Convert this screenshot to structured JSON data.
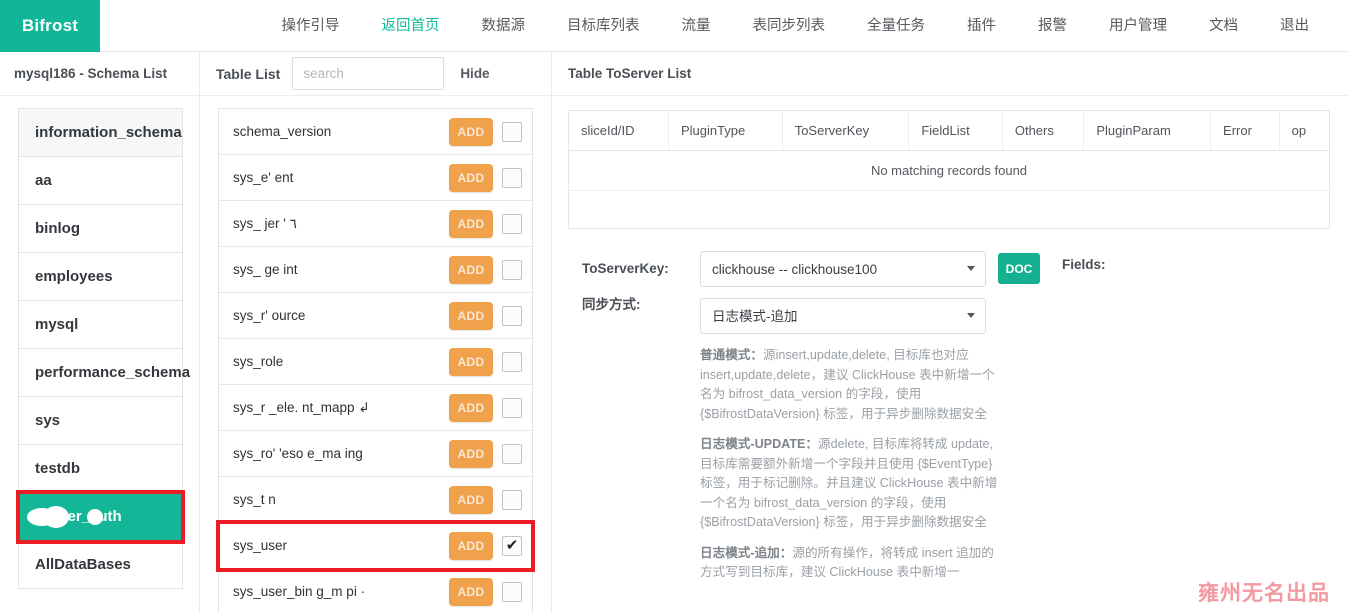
{
  "brand": {
    "name": "Bifrost"
  },
  "nav": {
    "items": [
      {
        "label": "操作引导",
        "active": false
      },
      {
        "label": "返回首页",
        "active": true
      },
      {
        "label": "数据源",
        "active": false
      },
      {
        "label": "目标库列表",
        "active": false
      },
      {
        "label": "流量",
        "active": false
      },
      {
        "label": "表同步列表",
        "active": false
      },
      {
        "label": "全量任务",
        "active": false
      },
      {
        "label": "插件",
        "active": false
      },
      {
        "label": "报警",
        "active": false
      },
      {
        "label": "用户管理",
        "active": false
      },
      {
        "label": "文档",
        "active": false
      },
      {
        "label": "退出",
        "active": false
      }
    ]
  },
  "schema_panel": {
    "title": "mysql186 - Schema List",
    "items": [
      {
        "label": "information_schema",
        "state": "hover"
      },
      {
        "label": "aa",
        "state": "normal"
      },
      {
        "label": "binlog",
        "state": "normal"
      },
      {
        "label": "employees",
        "state": "normal"
      },
      {
        "label": "mysql",
        "state": "normal"
      },
      {
        "label": "performance_schema",
        "state": "normal"
      },
      {
        "label": "sys",
        "state": "normal"
      },
      {
        "label": "testdb",
        "state": "normal"
      },
      {
        "label": "ranger_auth",
        "state": "selected"
      },
      {
        "label": "AllDataBases",
        "state": "normal"
      }
    ]
  },
  "table_panel": {
    "title": "Table List",
    "search_placeholder": "search",
    "search_value": "",
    "hide_label": "Hide",
    "add_label": "ADD",
    "checked_mark": "✔",
    "rows": [
      {
        "name": "schema_version",
        "checked": false,
        "highlight": false
      },
      {
        "name": "sys_e'   ent",
        "checked": false,
        "highlight": false
      },
      {
        "name": "sys_   jer '  ٦",
        "checked": false,
        "highlight": false
      },
      {
        "name": "sys_   ge   int",
        "checked": false,
        "highlight": false
      },
      {
        "name": "sys_r'  ource",
        "checked": false,
        "highlight": false
      },
      {
        "name": "sys_role",
        "checked": false,
        "highlight": false
      },
      {
        "name": "sys_r  _ele.  nt_mapp   ↲",
        "checked": false,
        "highlight": false
      },
      {
        "name": "sys_ro'  'eso   e_ma   ing",
        "checked": false,
        "highlight": false
      },
      {
        "name": "sys_t    n",
        "checked": false,
        "highlight": false
      },
      {
        "name": "sys_user",
        "checked": true,
        "highlight": true
      },
      {
        "name": "sys_user_bin    g_m   pi  ·",
        "checked": false,
        "highlight": false
      }
    ]
  },
  "right_panel": {
    "title": "Table ToServer List",
    "table": {
      "columns": [
        "sliceId/ID",
        "PluginType",
        "ToServerKey",
        "FieldList",
        "Others",
        "PluginParam",
        "Error",
        "op"
      ],
      "empty_message": "No matching records found",
      "rows": []
    },
    "form": {
      "toserverkey_label": "ToServerKey:",
      "toserverkey_value": "clickhouse -- clickhouse100",
      "toserverkey_options": [
        "clickhouse -- clickhouse100"
      ],
      "syncmode_label": "同步方式:",
      "syncmode_value": "日志模式-追加",
      "syncmode_options": [
        "普通模式",
        "日志模式-UPDATE",
        "日志模式-追加"
      ],
      "doc_label": "DOC",
      "fields_label": "Fields:"
    },
    "help": [
      {
        "title": "普通模式：",
        "body": "源insert,update,delete, 目标库也对应 insert,update,delete，建议 ClickHouse 表中新增一个名为 bifrost_data_version 的字段，使用 {$BifrostDataVersion} 标签，用于异步删除数据安全"
      },
      {
        "title": "日志模式-UPDATE：",
        "body": "源delete, 目标库将转成 update, 目标库需要额外新增一个字段并且使用 {$EventType}标签，用于标记删除。并且建议 ClickHouse 表中新增一个名为 bifrost_data_version 的字段，使用 {$BifrostDataVersion} 标签，用于异步删除数据安全"
      },
      {
        "title": "日志模式-追加：",
        "body": "源的所有操作，将转成 insert 追加的方式写到目标库，建议 ClickHouse 表中新增一"
      }
    ]
  },
  "watermark": {
    "text": "雍州无名出品",
    "color": "#f4909b"
  },
  "colors": {
    "brand_green": "#11b597",
    "accent_green": "#12b99b",
    "add_orange": "#f0a14b",
    "highlight_red": "#ec1c24",
    "doc_green": "#14b08f"
  }
}
